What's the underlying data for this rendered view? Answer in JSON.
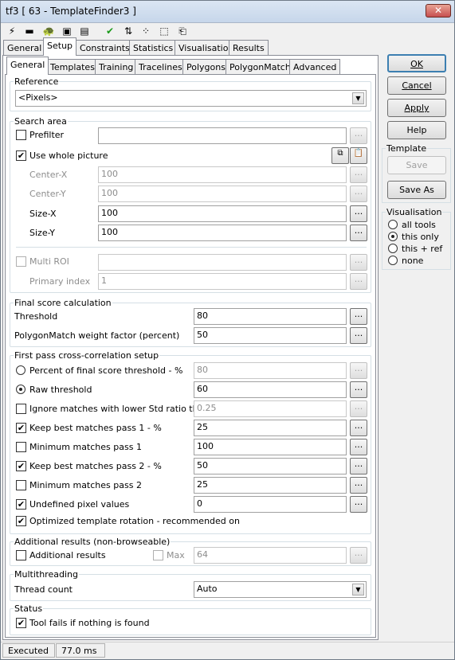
{
  "window": {
    "title": "tf3 [ 63 - TemplateFinder3 ]",
    "close": "✕"
  },
  "toolbar": [
    "⚡",
    "▬",
    "🐢",
    "▣",
    "▤",
    "✔",
    "⇅",
    "⁘",
    "⬚",
    "⎗"
  ],
  "top_tabs": [
    "General",
    "Setup",
    "Constraints",
    "Statistics",
    "Visualisation",
    "Results"
  ],
  "sub_tabs": [
    "General",
    "Templates",
    "Training",
    "Tracelines",
    "Polygons",
    "PolygonMatch",
    "Advanced"
  ],
  "reference": {
    "title": "Reference",
    "value": "<Pixels>"
  },
  "search": {
    "title": "Search area",
    "prefilter": "Prefilter",
    "whole": "Use whole picture",
    "cx": "Center-X",
    "cx_v": "100",
    "cy": "Center-Y",
    "cy_v": "100",
    "sx": "Size-X",
    "sx_v": "100",
    "sy": "Size-Y",
    "sy_v": "100",
    "multi": "Multi ROI",
    "pidx": "Primary index",
    "pidx_v": "1"
  },
  "final": {
    "title": "Final score calculation",
    "thr": "Threshold",
    "thr_v": "80",
    "pm": "PolygonMatch weight factor (percent)",
    "pm_v": "50"
  },
  "fp": {
    "title": "First pass cross-correlation setup",
    "r1": "Percent of final score threshold - %",
    "r1_v": "80",
    "r2": "Raw threshold",
    "r2_v": "60",
    "c1": "Ignore matches with lower Std ratio than",
    "c1_v": "0.25",
    "c2": "Keep best matches pass 1 - %",
    "c2_v": "25",
    "c3": "Minimum matches pass 1",
    "c3_v": "100",
    "c4": "Keep best matches pass 2 - %",
    "c4_v": "50",
    "c5": "Minimum matches pass 2",
    "c5_v": "25",
    "c6": "Undefined pixel values",
    "c6_v": "0",
    "c7": "Optimized template rotation - recommended on"
  },
  "addl": {
    "title": "Additional results (non-browseable)",
    "label": "Additional results",
    "max": "Max",
    "max_v": "64"
  },
  "mt": {
    "title": "Multithreading",
    "label": "Thread count",
    "value": "Auto"
  },
  "status_grp": {
    "title": "Status",
    "label": "Tool fails if nothing is found"
  },
  "buttons": {
    "ok": "OK",
    "cancel": "Cancel",
    "apply": "Apply",
    "help": "Help"
  },
  "template": {
    "title": "Template",
    "save": "Save",
    "saveas": "Save As"
  },
  "vis": {
    "title": "Visualisation",
    "o1": "all tools",
    "o2": "this only",
    "o3": "this + ref",
    "o4": "none"
  },
  "statusbar": {
    "state": "Executed",
    "time": "77.0 ms"
  },
  "ellipsis": "...",
  "check": "✔",
  "arrow": "▼"
}
